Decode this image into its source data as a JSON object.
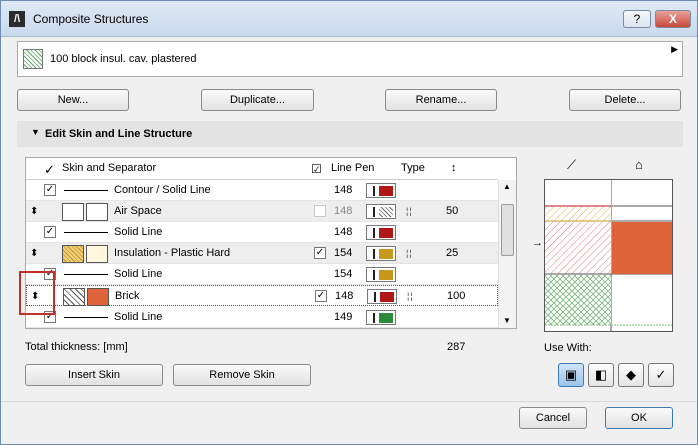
{
  "window": {
    "title": "Composite Structures",
    "help_label": "?",
    "close_label": "X"
  },
  "structure": {
    "name": "100 block insul. cav. plastered"
  },
  "buttons": {
    "new": "New...",
    "duplicate": "Duplicate...",
    "rename": "Rename...",
    "delete": "Delete..."
  },
  "section": {
    "title": "Edit Skin and Line Structure"
  },
  "table": {
    "headers": {
      "check": "",
      "skin": "Skin and Separator",
      "linepen": "Line Pen",
      "type": "Type",
      "thickness": ""
    },
    "rows": [
      {
        "kind": "line",
        "checked": true,
        "name": "Contour / Solid Line",
        "pen": "148",
        "pen_color": "#b01818",
        "pen_check": "",
        "thickness": ""
      },
      {
        "kind": "skin",
        "name": "Air Space",
        "pen_check": "unchecked-disabled",
        "pen": "148",
        "pen_color": "#555555",
        "thickness": "50"
      },
      {
        "kind": "line",
        "checked": true,
        "name": "Solid Line",
        "pen": "148",
        "pen_color": "#b01818",
        "thickness": ""
      },
      {
        "kind": "skin",
        "name": "Insulation - Plastic Hard",
        "pen_check": "checked",
        "pen": "154",
        "pen_color": "#c8971e",
        "thickness": "25"
      },
      {
        "kind": "line",
        "checked": true,
        "name": "Solid Line",
        "pen": "154",
        "pen_color": "#c8971e",
        "thickness": ""
      },
      {
        "kind": "skin",
        "name": "Brick",
        "pen_check": "checked",
        "pen": "148",
        "pen_color": "#b01818",
        "thickness": "100"
      },
      {
        "kind": "line",
        "checked": true,
        "name": "Solid Line",
        "pen": "149",
        "pen_color": "#2a8a3a",
        "thickness": ""
      }
    ]
  },
  "total": {
    "label": "Total thickness: [mm]",
    "value": "287"
  },
  "skin_buttons": {
    "insert": "Insert Skin",
    "remove": "Remove Skin"
  },
  "use_with": {
    "label": "Use With:"
  },
  "dialog": {
    "cancel": "Cancel",
    "ok": "OK"
  },
  "colors": {
    "brick": "#e0643a",
    "insulation": "#f0d080",
    "accent": "#3d79b6"
  }
}
